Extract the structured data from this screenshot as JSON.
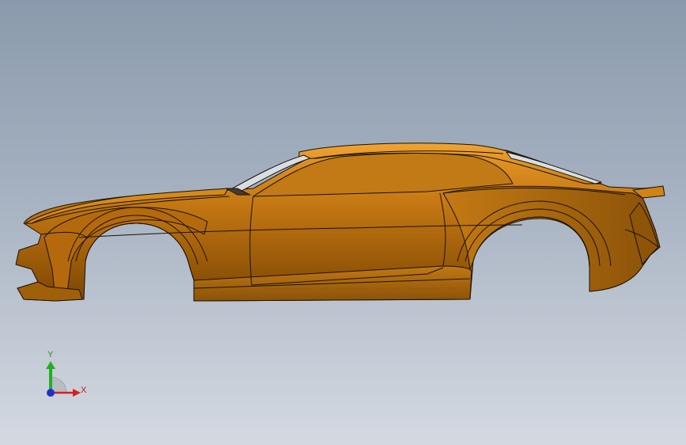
{
  "viewport": {
    "background_top": "#8a9aac",
    "background_bottom": "#d4d9e1"
  },
  "model": {
    "body_color": "#c97a12",
    "body_shadow": "#7d4a06",
    "edge_color": "#1a1205",
    "glass_color": "#d9dde3"
  },
  "triad": {
    "x_label": "X",
    "y_label": "Y",
    "x_color": "#d42020",
    "y_color": "#20b020",
    "z_color": "#2030d0"
  }
}
